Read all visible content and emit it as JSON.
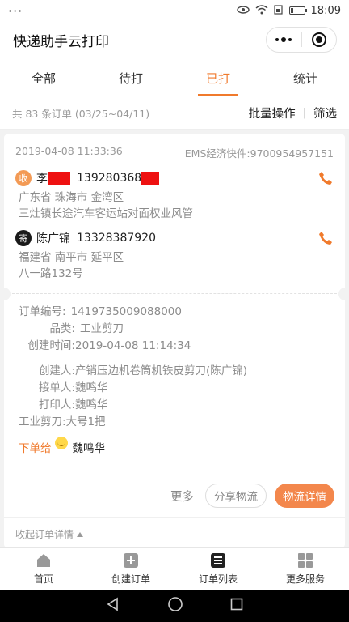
{
  "status": {
    "time": "18:09",
    "left": "···"
  },
  "app": {
    "title": "快递助手云打印"
  },
  "tabs": [
    "全部",
    "待打",
    "已打",
    "统计"
  ],
  "summary": {
    "text": "共 83 条订单 (03/25~04/11)",
    "batch": "批量操作",
    "sep": "|",
    "filter": "筛选"
  },
  "order": {
    "datetime": "2019-04-08 11:33:36",
    "express": "EMS经济快件:9700954957151",
    "receiver": {
      "tag": "收",
      "name": "李",
      "phone": "139280368",
      "province": "广东省 珠海市 金湾区",
      "address": "三灶镇长途汽车客运站对面权业风管"
    },
    "sender": {
      "tag": "寄",
      "name": "陈广锦",
      "phone": "13328387920",
      "province": "福建省 南平市 延平区",
      "address": "八一路132号"
    },
    "order_no_label": "订单编号:",
    "order_no": "1419735009088000",
    "category_label": "品类:",
    "category": "工业剪刀",
    "created_label": "创建时间:",
    "created": "2019-04-08 11:14:34",
    "creator_label": "创建人:",
    "creator": "产销压边机卷筒机铁皮剪刀(陈广锦)",
    "taker_label": "接单人:",
    "taker": "魏鸣华",
    "printer_label": "打印人:",
    "printer": "魏鸣华",
    "goods": "工业剪刀:大号1把",
    "assign_label": "下单给",
    "assignee": "魏鸣华",
    "more": "更多",
    "share": "分享物流",
    "detail": "物流详情",
    "collapse": "收起订单详情"
  },
  "nav": [
    "首页",
    "创建订单",
    "订单列表",
    "更多服务"
  ],
  "colors": {
    "accent": "#f07a2c",
    "button": "#f3874c",
    "redact": "#ee1111"
  },
  "icons": {
    "receiver_tag": "receiver-tag-icon",
    "sender_tag": "sender-tag-icon",
    "phone": "phone-icon",
    "home": "home-icon",
    "create": "add-icon",
    "orders": "list-icon",
    "services": "grid-icon"
  }
}
